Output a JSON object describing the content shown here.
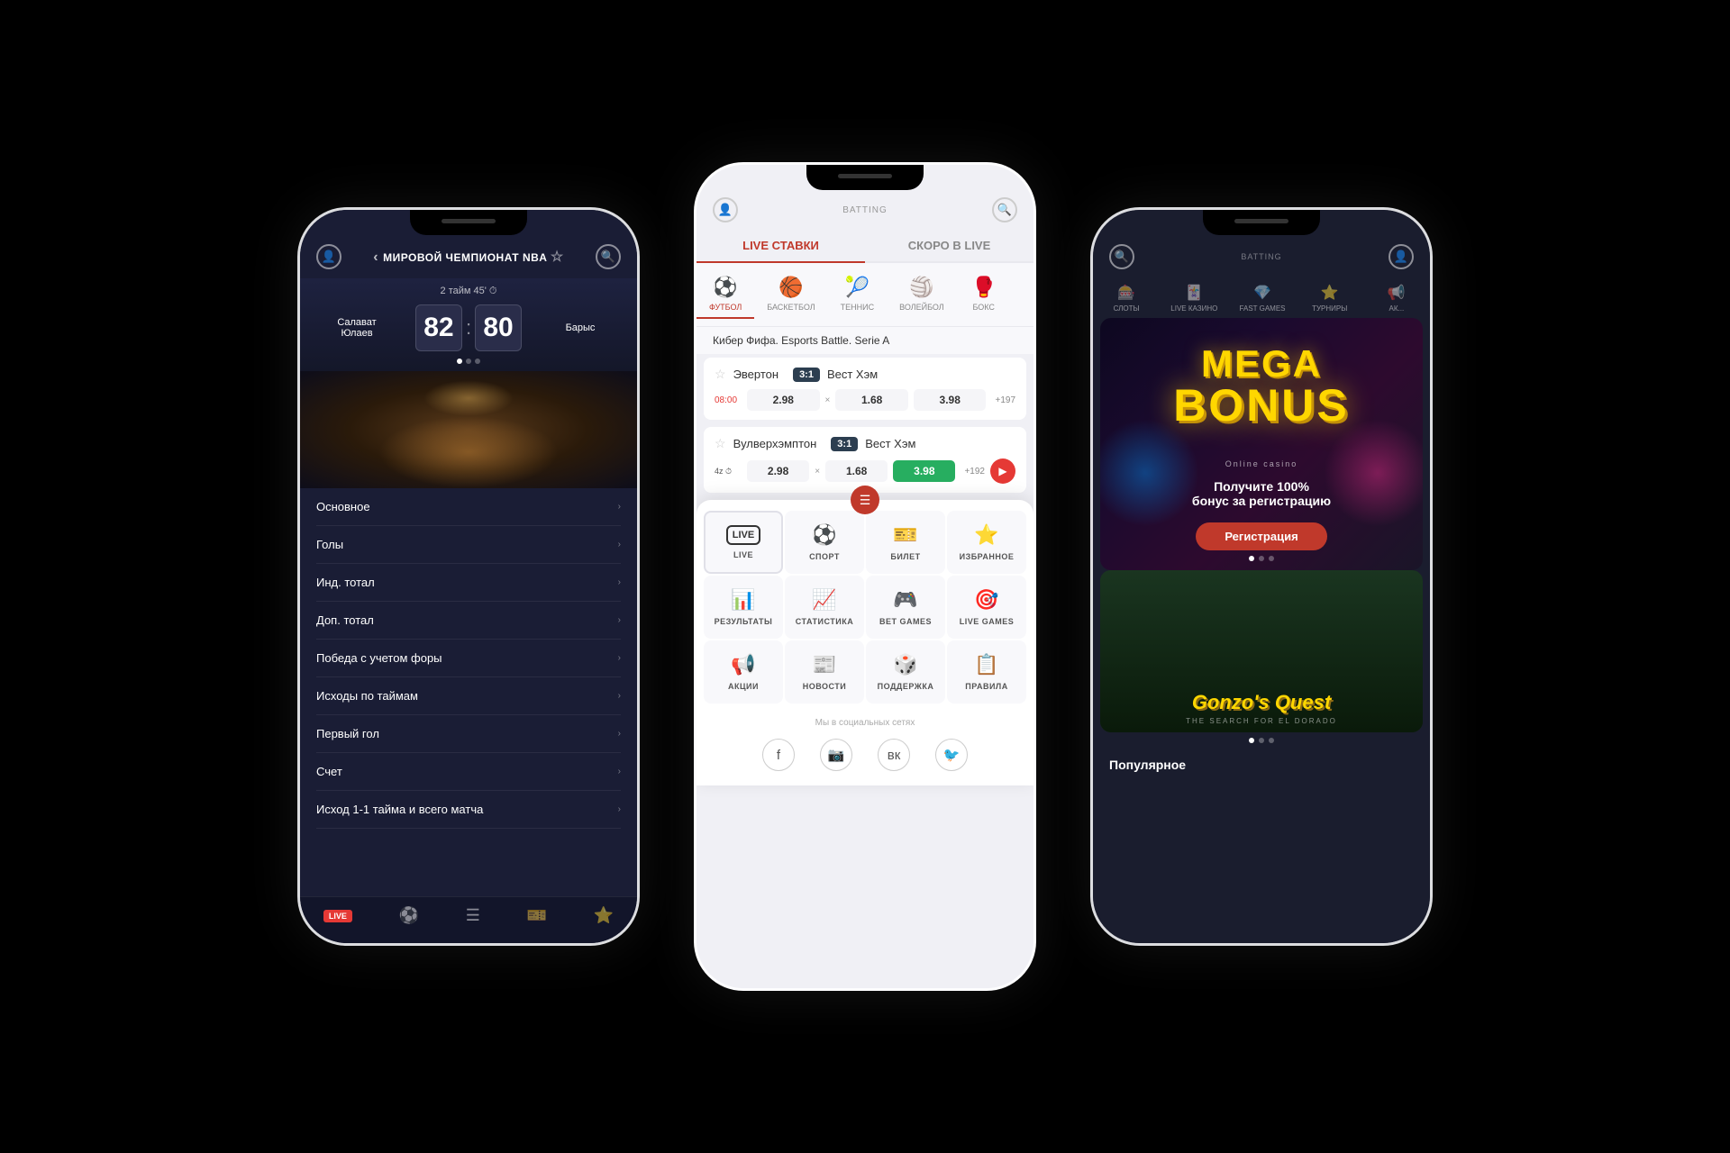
{
  "phone1": {
    "header": {
      "title": "МИРОВОЙ ЧЕМПИОНАТ NBA",
      "userIcon": "👤",
      "searchIcon": "🔍"
    },
    "scoreboard": {
      "timer": "2 тайм 45'",
      "team1": "Салават Юлаев",
      "team2": "Барыс",
      "score1": "82",
      "score2": "80"
    },
    "menu": [
      {
        "label": "Основное"
      },
      {
        "label": "Голы"
      },
      {
        "label": "Инд. тотал"
      },
      {
        "label": "Доп. тотал"
      },
      {
        "label": "Победа с учетом форы"
      },
      {
        "label": "Исходы по таймам"
      },
      {
        "label": "Первый гол"
      },
      {
        "label": "Счет"
      },
      {
        "label": "Исход 1-1 тайма и всего матча"
      }
    ],
    "bottomBar": [
      {
        "label": "LIVE",
        "type": "badge"
      },
      {
        "label": "⚽",
        "type": "icon"
      },
      {
        "label": "☰",
        "type": "icon"
      },
      {
        "label": "🎫",
        "type": "icon"
      },
      {
        "label": "⭐",
        "type": "icon"
      }
    ]
  },
  "phone2": {
    "header": {
      "headerText": "BATTING",
      "userIcon": "👤",
      "searchIcon": "🔍"
    },
    "tabs": [
      {
        "label": "LIVE СТАВКИ",
        "active": true
      },
      {
        "label": "СКОРО В LIVE",
        "active": false
      }
    ],
    "sports": [
      {
        "label": "ФУТБОЛ",
        "icon": "⚽",
        "active": true
      },
      {
        "label": "БАСКЕТБОЛ",
        "icon": "🏀",
        "active": false
      },
      {
        "label": "ТЕННИС",
        "icon": "🎾",
        "active": false
      },
      {
        "label": "ВОЛЕЙБОЛ",
        "icon": "🏐",
        "active": false
      },
      {
        "label": "БОКС",
        "icon": "🥊",
        "active": false
      }
    ],
    "sectionHeader": "Кибер Фифа. Esports Battle. Serie A",
    "matches": [
      {
        "team1": "Эвертон",
        "team2": "Вест Хэм",
        "score": "3:1",
        "time": "08:00",
        "odds": [
          "2.98",
          "1.68",
          "3.98"
        ],
        "more": "+197",
        "highlightIndex": -1
      },
      {
        "team1": "Вулверхэмптон",
        "team2": "Вест Хэм",
        "score": "3:1",
        "time": "4z",
        "odds": [
          "2.98",
          "1.68",
          "3.98"
        ],
        "more": "+192",
        "highlightIndex": 2,
        "hasPlay": true
      }
    ],
    "navGrid": [
      {
        "label": "LIVE",
        "icon": "LIVE",
        "type": "live"
      },
      {
        "label": "СПОРТ",
        "icon": "⚽",
        "type": "icon"
      },
      {
        "label": "БИЛЕТ",
        "icon": "🎫",
        "type": "icon"
      },
      {
        "label": "ИЗБРАННОЕ",
        "icon": "⭐",
        "type": "icon"
      },
      {
        "label": "РЕЗУЛЬТАТЫ",
        "icon": "📊",
        "type": "icon"
      },
      {
        "label": "СТАТИСТИКА",
        "icon": "📈",
        "type": "icon"
      },
      {
        "label": "BET GAMES",
        "icon": "🎮",
        "type": "icon"
      },
      {
        "label": "LIVE GAMES",
        "icon": "🎯",
        "type": "icon"
      },
      {
        "label": "АКЦИИ",
        "icon": "📢",
        "type": "icon"
      },
      {
        "label": "НОВОСТИ",
        "icon": "📰",
        "type": "icon"
      },
      {
        "label": "ПОДДЕРЖКА",
        "icon": "🎲",
        "type": "icon"
      },
      {
        "label": "ПРАВИЛА",
        "icon": "📋",
        "type": "icon"
      }
    ],
    "socialHeader": "Мы в социальных сетях",
    "socialIcons": [
      "f",
      "ig",
      "vk",
      "tw"
    ]
  },
  "phone3": {
    "header": {
      "searchIcon": "🔍",
      "headerText": "BATTING",
      "userIcon": "👤"
    },
    "navItems": [
      {
        "label": "СЛОТЫ",
        "icon": "🎰"
      },
      {
        "label": "LIVE КАЗИНО",
        "icon": "🃏"
      },
      {
        "label": "FAST GAMES",
        "icon": "💎"
      },
      {
        "label": "ТУРНИРЫ",
        "icon": "⭐"
      },
      {
        "label": "АК...",
        "icon": "📢"
      }
    ],
    "banner": {
      "megaText": "MEGA",
      "bonusText": "BONUS",
      "casinoLabel": "Online casino",
      "description": "Получите 100%\nбонус за регистрацию",
      "buttonLabel": "Регистрация"
    },
    "gameCard": {
      "title": "Gonzo's Quest",
      "subtitle": "THE SEARCH FOR EL DORADO"
    },
    "popularLabel": "Популярное"
  }
}
